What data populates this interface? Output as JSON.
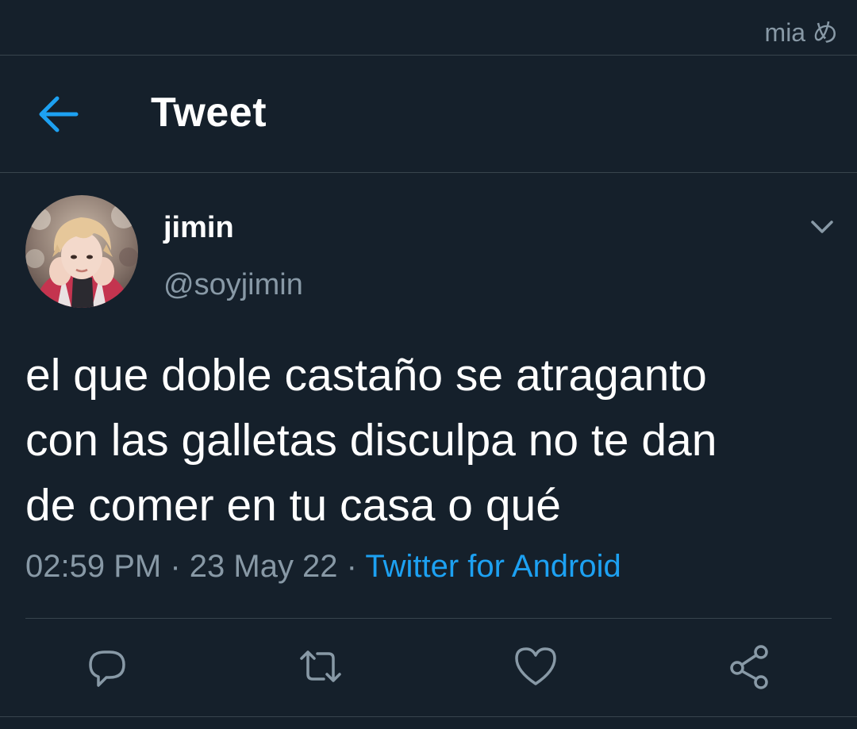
{
  "status_bar": {
    "text": "mia め"
  },
  "header": {
    "title": "Tweet",
    "back_icon": "arrow-left-icon"
  },
  "tweet": {
    "author": {
      "display_name": "jimin",
      "handle": "@soyjimin",
      "avatar": "profile-photo"
    },
    "text_lines": [
      "el que doble castaño se atraganto",
      "con las galletas disculpa no te dan",
      "de comer en tu casa o qué"
    ],
    "time": "02:59 PM",
    "sep1": " · ",
    "date": "23 May 22",
    "sep2": " · ",
    "source": "Twitter for Android"
  },
  "actions": {
    "reply_icon": "reply-icon",
    "retweet_icon": "retweet-icon",
    "like_icon": "heart-icon",
    "share_icon": "share-icon"
  },
  "colors": {
    "background": "#15202b",
    "accent": "#1da1f2",
    "secondary_text": "#8899a6",
    "divider": "#38444d"
  }
}
